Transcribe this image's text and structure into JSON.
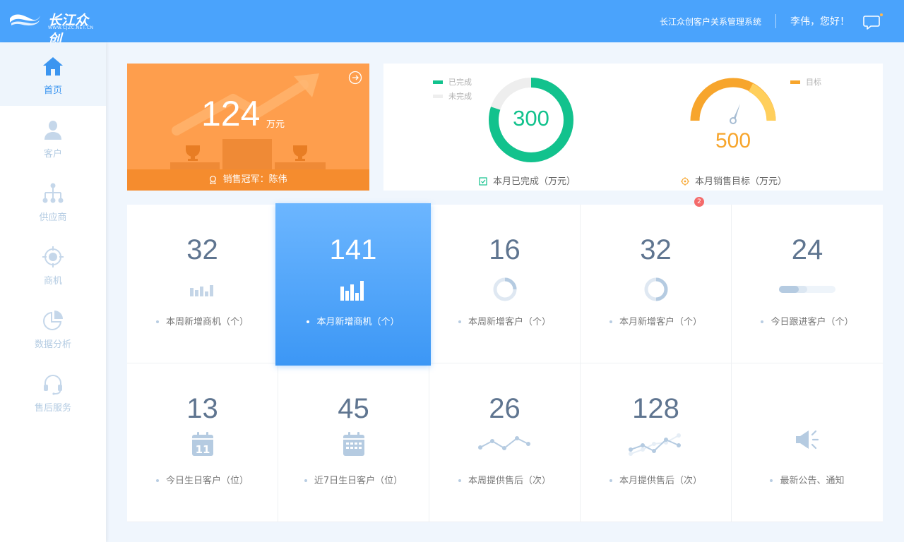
{
  "header": {
    "brand_name": "长江众创",
    "brand_url": "WWW.CJZC.NET.CN",
    "system_title": "长江众创客户关系管理系统",
    "greeting": "李伟，您好！",
    "icons": {
      "logo": "wave-logo-icon",
      "messages": "chat-bubble-icon"
    }
  },
  "sidebar": {
    "items": [
      {
        "label": "首页",
        "icon": "home-icon",
        "active": true
      },
      {
        "label": "客户",
        "icon": "user-icon",
        "active": false
      },
      {
        "label": "供应商",
        "icon": "org-tree-icon",
        "active": false
      },
      {
        "label": "商机",
        "icon": "target-icon",
        "active": false
      },
      {
        "label": "数据分析",
        "icon": "pie-chart-icon",
        "active": false
      },
      {
        "label": "售后服务",
        "icon": "headset-icon",
        "active": false
      }
    ]
  },
  "champion_card": {
    "value": "124",
    "unit": "万元",
    "footer": "销售冠军：陈伟",
    "icons": {
      "go": "arrow-right-circle-icon",
      "medal": "medal-icon"
    }
  },
  "completion": {
    "legend": [
      "已完成",
      "未完成"
    ],
    "value": "300",
    "completed_fraction": 0.8,
    "caption": "本月已完成（万元）",
    "colors": {
      "done": "#12c28d",
      "remaining": "#eeeeee"
    }
  },
  "target": {
    "legend": [
      "目标"
    ],
    "value": "500",
    "caption": "本月销售目标（万元）",
    "colors": {
      "arc": "#f7a52c"
    }
  },
  "stats": [
    {
      "value": "32",
      "label": "本周新增商机（个）",
      "icon": "bar-chart-icon"
    },
    {
      "value": "141",
      "label": "本月新增商机（个）",
      "icon": "bar-chart-icon",
      "highlight": true
    },
    {
      "value": "16",
      "label": "本周新增客户（个）",
      "icon": "ring-progress-icon"
    },
    {
      "value": "32",
      "label": "本月新增客户（个）",
      "icon": "ring-progress-icon"
    },
    {
      "value": "24",
      "label": "今日跟进客户（个）",
      "icon": "progress-bar-icon"
    },
    {
      "value": "13",
      "label": "今日生日客户（位）",
      "icon": "calendar-day-icon",
      "calendar_day": "11"
    },
    {
      "value": "45",
      "label": "近7日生日客户（位）",
      "icon": "calendar-week-icon"
    },
    {
      "value": "26",
      "label": "本周提供售后（次）",
      "icon": "line-chart-icon"
    },
    {
      "value": "128",
      "label": "本月提供售后（次）",
      "icon": "multi-line-chart-icon"
    },
    {
      "value": "",
      "label": "最新公告、通知",
      "icon": "megaphone-icon",
      "badge": "2"
    }
  ],
  "colors": {
    "header": "#4aa3fc",
    "accent": "#3b95f0",
    "champion": "#fe9e4d"
  }
}
